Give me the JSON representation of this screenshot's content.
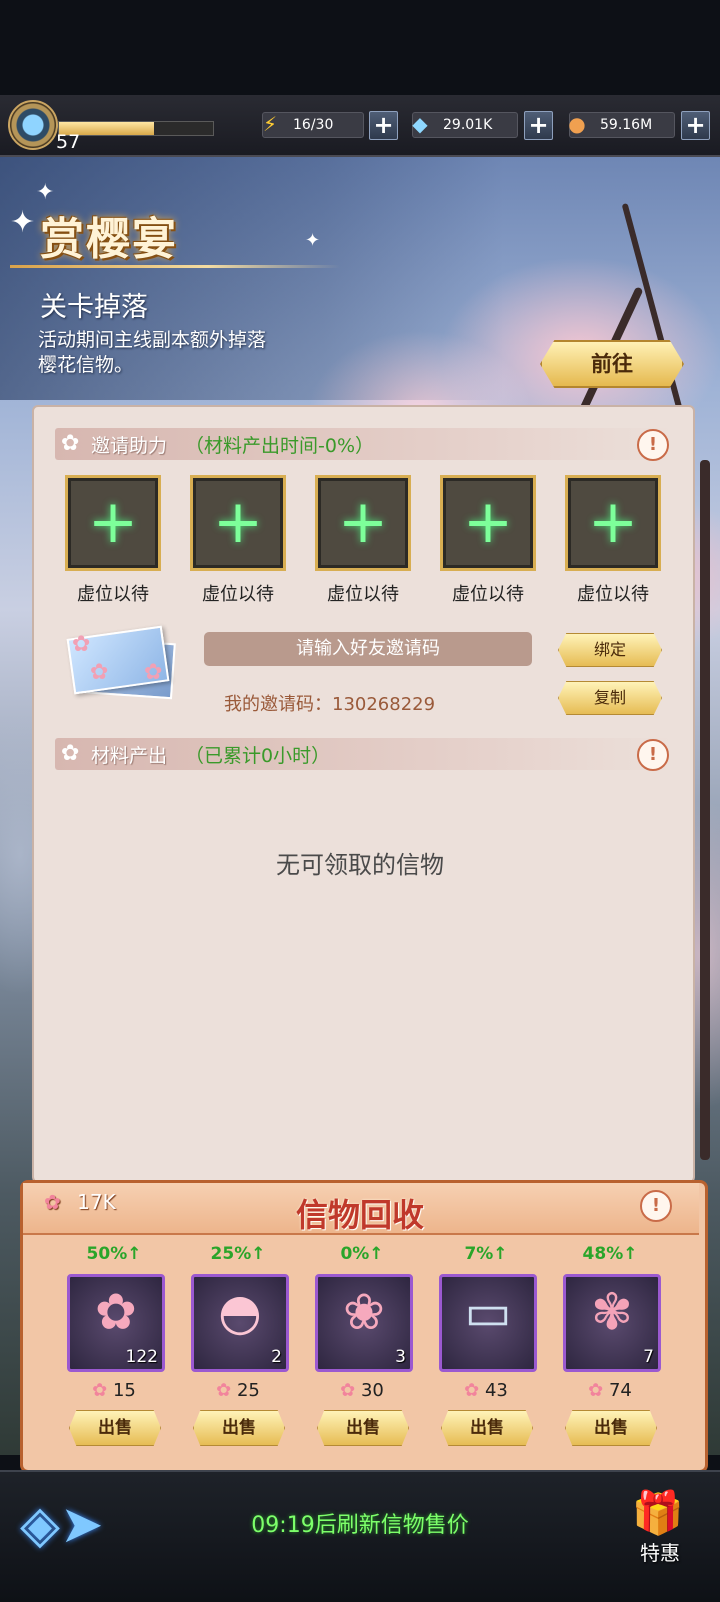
{
  "topbar": {
    "level": "57",
    "xp_fraction": 0.62,
    "stamina": "16/30",
    "diamonds": "29.01K",
    "coins": "59.16M"
  },
  "banner": {
    "title": "赏樱宴",
    "stage_title": "关卡掉落",
    "stage_desc": "活动期间主线副本额外掉落樱花信物。",
    "goto_label": "前往"
  },
  "invite": {
    "header_title": "邀请助力",
    "header_sub": "（材料产出时间-0%）",
    "slots": [
      {
        "label": "虚位以待"
      },
      {
        "label": "虚位以待"
      },
      {
        "label": "虚位以待"
      },
      {
        "label": "虚位以待"
      },
      {
        "label": "虚位以待"
      }
    ],
    "input_placeholder": "请输入好友邀请码",
    "bind_label": "绑定",
    "copy_label": "复制",
    "my_code": "我的邀请码：130268229"
  },
  "output": {
    "header_title": "材料产出",
    "header_sub": "（已累计0小时）",
    "empty_text": "无可领取的信物"
  },
  "recycle": {
    "title": "信物回收",
    "petals": "17K",
    "items": [
      {
        "pct": "50%↑",
        "count": "122",
        "price": "15",
        "sell": "出售",
        "icon": "sakura-charm-icon"
      },
      {
        "pct": "25%↑",
        "count": "2",
        "price": "25",
        "sell": "出售",
        "icon": "sakura-fan-icon"
      },
      {
        "pct": "0%↑",
        "count": "3",
        "price": "30",
        "sell": "出售",
        "icon": "sakura-hairpin-icon"
      },
      {
        "pct": "7%↑",
        "count": "",
        "price": "43",
        "sell": "出售",
        "icon": "postcard-icon"
      },
      {
        "pct": "48%↑",
        "count": "7",
        "price": "74",
        "sell": "出售",
        "icon": "bouquet-icon"
      }
    ]
  },
  "bottom": {
    "refresh_text": "09:19后刷新信物售价",
    "gift_label": "特惠"
  }
}
